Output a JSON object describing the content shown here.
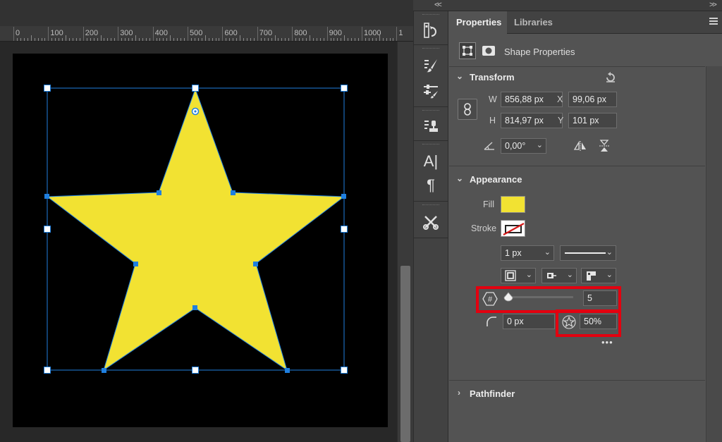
{
  "ruler": {
    "labels": [
      "0",
      "100",
      "200",
      "300",
      "400",
      "500",
      "600",
      "700",
      "800",
      "900",
      "1000",
      "1"
    ]
  },
  "collapse": {
    "left": "<<",
    "right": ">>"
  },
  "panel": {
    "tabs": [
      {
        "label": "Properties",
        "active": true
      },
      {
        "label": "Libraries",
        "active": false
      }
    ],
    "shape_properties_label": "Shape Properties",
    "transform": {
      "title": "Transform",
      "w_label": "W",
      "w_value": "856,88 px",
      "x_label": "X",
      "x_value": "99,06 px",
      "h_label": "H",
      "h_value": "814,97 px",
      "y_label": "Y",
      "y_value": "101 px",
      "angle_value": "0,00°"
    },
    "appearance": {
      "title": "Appearance",
      "fill_label": "Fill",
      "fill_color": "#f2e232",
      "stroke_label": "Stroke",
      "stroke_width": "1 px",
      "points_value": "5",
      "corner_radius": "0 px",
      "star_ratio": "50%",
      "more": "•••"
    },
    "pathfinder": {
      "title": "Pathfinder"
    }
  },
  "colors": {
    "highlight": "#e3000f",
    "selection": "#1f7fe0",
    "star_fill": "#f2e232"
  }
}
